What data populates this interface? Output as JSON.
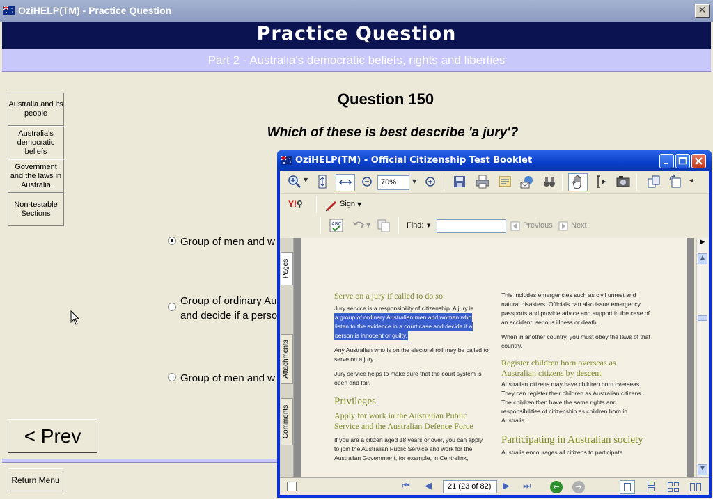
{
  "main_window": {
    "title": "OziHELP(TM) - Practice Question",
    "close_glyph": "✕"
  },
  "header": {
    "title": "Practice Question",
    "subtitle": "Part 2 - Australia's democratic beliefs, rights and liberties"
  },
  "sidebar": {
    "items": [
      {
        "label": "Australia and its people"
      },
      {
        "label": "Australia's democratic beliefs"
      },
      {
        "label": "Government and the laws in Australia"
      },
      {
        "label": "Non-testable Sections"
      }
    ]
  },
  "question": {
    "number": "Question 150",
    "text": "Which of these is best describe 'a jury'?",
    "options": [
      {
        "line1": "Group of men and w",
        "line2": "",
        "selected": true
      },
      {
        "line1": "Group of ordinary Au",
        "line2": "and decide if a perso",
        "selected": false
      },
      {
        "line1": "Group of men and w",
        "line2": "",
        "selected": false
      }
    ]
  },
  "buttons": {
    "prev": "< Prev",
    "return_menu": "Return Menu"
  },
  "booklet": {
    "title": "OziHELP(TM) - Official Citizenship Test Booklet",
    "zoom": "70%",
    "sign_label": "Sign",
    "find_label": "Find:",
    "previous_label": "Previous",
    "next_label": "Next",
    "side_tabs": [
      "Pages",
      "Attachments",
      "Comments"
    ],
    "page_indicator": "21  (23 of 82)",
    "doc": {
      "col1": {
        "heading1": "Serve on a jury if called to do so",
        "p1_plain": "Jury service is a responsibility of citizenship. A jury is",
        "p1_highlight": [
          "a group of ordinary Australian men and women who",
          "listen to the evidence in a court case and decide if a",
          "person is innocent or guilty."
        ],
        "p2": "Any Australian who is on the electoral roll may be called to serve on a jury.",
        "p3": "Jury service helps to make sure that the court system is open and fair.",
        "heading2": "Privileges",
        "heading3": "Apply for work in the Australian Public Service and the Australian Defence Force",
        "p4": "If you are a citizen aged 18 years or over, you can apply to join the Australian Public Service and work for the Australian Government, for example, in Centrelink,"
      },
      "col2": {
        "p1": "This includes emergencies such as civil unrest and natural disasters. Officials can also issue emergency passports and provide advice and support in the case of an accident, serious illness or death.",
        "p2": "When in another country, you must obey the laws of that country.",
        "heading1": "Register children born overseas as Australian citizens by descent",
        "p3": "Australian citizens may have children born overseas. They can register their children as Australian citizens. The children then have the same rights and responsibilities of citizenship as children born in Australia.",
        "heading2": "Participating in Australian society",
        "p4": "Australia encourages all citizens to participate"
      }
    }
  }
}
